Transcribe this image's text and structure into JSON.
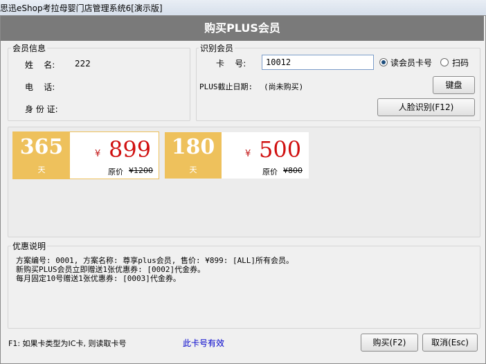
{
  "window": {
    "title": "思迅eShop考拉母婴门店管理系统6[演示版]"
  },
  "header": {
    "title": "购买PLUS会员"
  },
  "member_info": {
    "group_title": "会员信息",
    "name_label": "姓    名:",
    "name_value": "222",
    "phone_label": "电    话:",
    "phone_value": "",
    "id_label": "身 份 证:",
    "id_value": ""
  },
  "identify": {
    "group_title": "识别会员",
    "card_label": "卡    号:",
    "card_value": "10012",
    "radio_card_label": "读会员卡号",
    "radio_scan_label": "扫码",
    "selected": "card",
    "plus_label": "PLUS截止日期:",
    "plus_value": "(尚未购买)",
    "keyboard_button": "键盘",
    "face_button": "人脸识别(F12)"
  },
  "plans": [
    {
      "days": "365",
      "unit": "天",
      "currency": "¥",
      "price": "899",
      "orig_label": "原价",
      "orig_price": "¥1200",
      "selected": true
    },
    {
      "days": "180",
      "unit": "天",
      "currency": "¥",
      "price": "500",
      "orig_label": "原价",
      "orig_price": "¥800",
      "selected": false
    }
  ],
  "promo": {
    "group_title": "优惠说明",
    "lines": [
      "方案编号: 0001, 方案名称: 尊享plus会员, 售价: ¥899: [ALL]所有会员。",
      "新购买PLUS会员立即赠送1张优惠券: [0002]代金券。",
      "每月固定10号赠送1张优惠券: [0003]代金券。"
    ]
  },
  "footer": {
    "hint": "F1: 如果卡类型为IC卡, 则读取卡号",
    "valid_link": "此卡号有效",
    "buy_button": "购买(F2)",
    "cancel_button": "取消(Esc)"
  },
  "colors": {
    "header_bg": "#7a7a7a",
    "plan_accent": "#eec15c",
    "price_red": "#d01010",
    "link_blue": "#0000cc"
  }
}
